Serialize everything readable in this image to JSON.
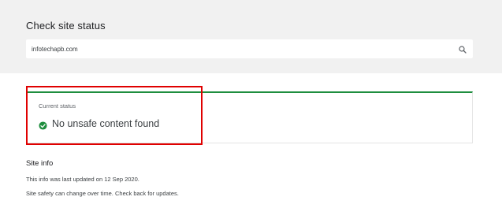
{
  "header": {
    "title": "Check site status"
  },
  "search": {
    "value": "infotechapb.com",
    "icon": "search-icon"
  },
  "status": {
    "label": "Current status",
    "text": "No unsafe content found",
    "icon": "check-circle-icon",
    "accent_color": "#1e8e3e"
  },
  "highlight": {
    "color": "#e00000"
  },
  "site_info": {
    "title": "Site info",
    "updated_line": "This info was last updated on 12 Sep 2020.",
    "note_line": "Site safety can change over time. Check back for updates."
  }
}
